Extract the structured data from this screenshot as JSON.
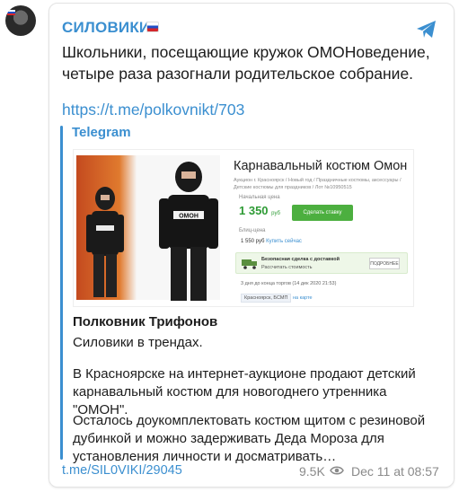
{
  "post": {
    "channel_name": "СИЛОВИКИ",
    "headline": "Школьники, посещающие кружок ОМОНоведение, четыре раза разогнали родительское собрание.",
    "link": "https://t.me/polkovnikt/703",
    "preview": {
      "site_name": "Telegram",
      "image": {
        "lot_title": "Карнавальный костюм Омон",
        "lot_subtitle": "Аукцион г. Красноярск / Новый год / Праздничные костюмы, аксессуары / Детские костюмы для праздников / Лот №10950515",
        "start_label": "Начальная цена",
        "price": "1 350",
        "price_unit": "руб",
        "bid_button": "Сделать ставку",
        "blitz_label": "Блиц-цена",
        "blitz_price": "1 550 руб",
        "blitz_action": "Купить сейчас",
        "safe_title": "Безопасная сделка с доставкой",
        "safe_sub": "Рассчитать стоимость",
        "safe_button": "ПОДРОБНЕЕ",
        "ends": "3 дня до конца торгов (14 дек 2020 21:53)",
        "location": "Красноярск, БСМП",
        "map_link": "на карте",
        "vest_label": "ОМОН"
      },
      "author": "Полковник Трифонов",
      "author_subtitle": "Силовики в трендах.",
      "paragraph_1": "В Красноярске на интернет-аукционе продают детский карнавальный костюм для новогоднего утренника \"ОМОН\".",
      "paragraph_2": "Осталось доукомплектовать костюм щитом с резиновой дубинкой и можно задерживать Деда Мороза для установления личности и досматривать…"
    },
    "footer": {
      "post_link": "t.me/SIL0VIKI/29045",
      "views": "9.5K",
      "date": "Dec 11 at 08:57"
    }
  },
  "icons": {
    "telegram": "telegram-plane-icon",
    "views": "eye-icon",
    "flag": "russia-flag-icon"
  },
  "colors": {
    "accent": "#3b8fd0",
    "text": "#1c1c1c",
    "muted": "#8a8a8a",
    "price_green": "#2e9b35",
    "button_green": "#4caf3f"
  }
}
